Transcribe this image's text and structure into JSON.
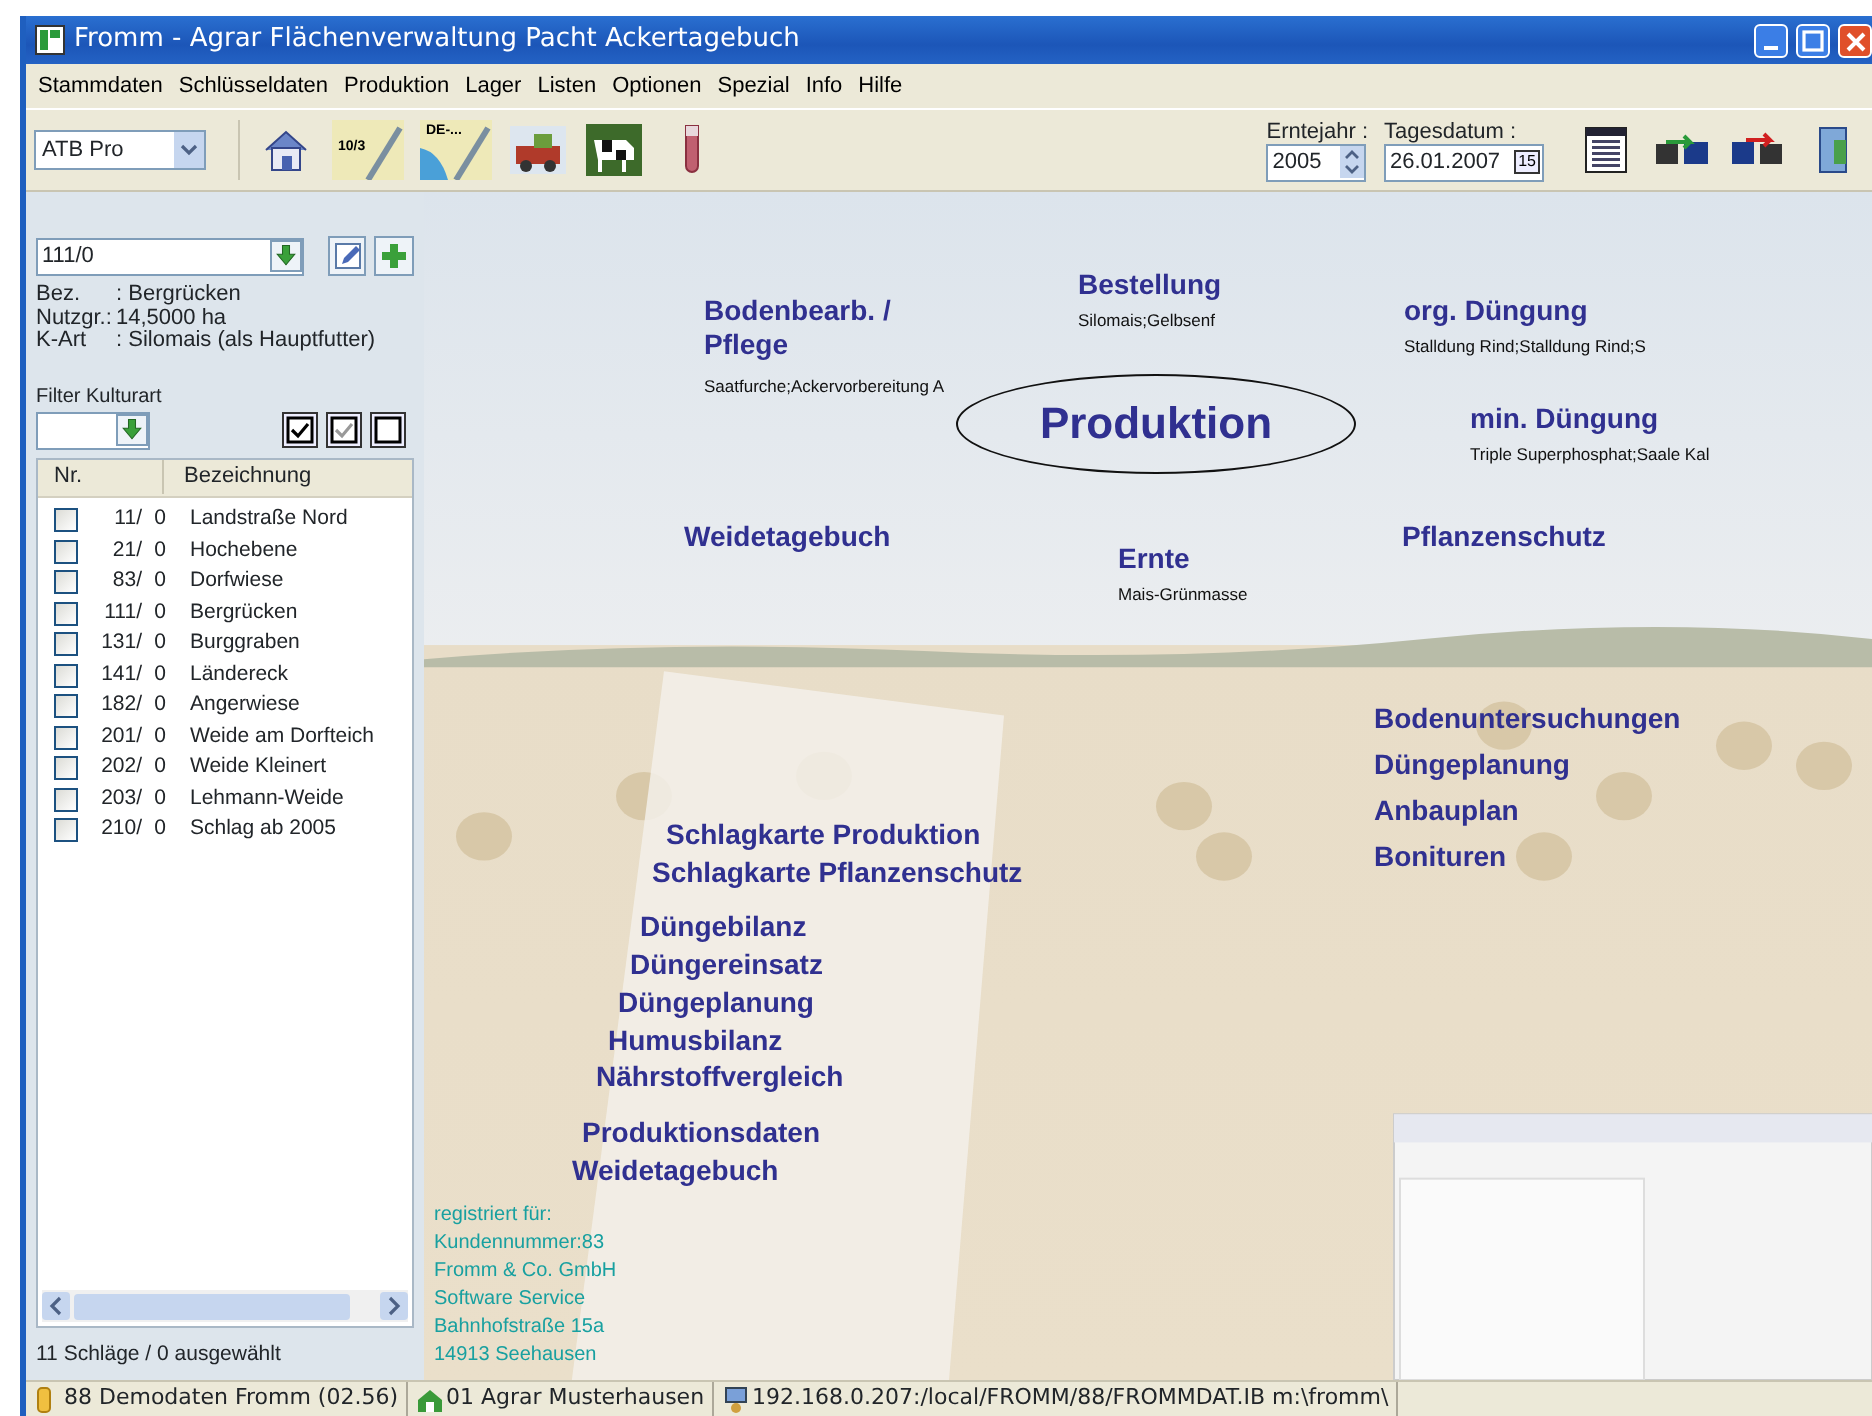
{
  "window": {
    "title": "Fromm - Agrar Flächenverwaltung Pacht Ackertagebuch"
  },
  "menu": [
    "Stammdaten",
    "Schlüsseldaten",
    "Produktion",
    "Lager",
    "Listen",
    "Optionen",
    "Spezial",
    "Info",
    "Hilfe"
  ],
  "toolbar": {
    "profile": "ATB Pro",
    "icon_texts": [
      "10/3",
      "DE-..."
    ],
    "harvest_year": {
      "label": "Erntejahr :",
      "value": "2005"
    },
    "date": {
      "label": "Tagesdatum :",
      "value": "26.01.2007",
      "button": "15"
    }
  },
  "sidebar": {
    "field_value": "111/0",
    "details": [
      {
        "label": "Bez.",
        "value": ": Bergrücken"
      },
      {
        "label": "Nutzgr.:",
        "value": "14,5000 ha"
      },
      {
        "label": "K-Art",
        "value": ": Silomais (als Hauptfutter)"
      }
    ],
    "filter_label": "Filter Kulturart",
    "columns": [
      "Nr.",
      "Bezeichnung"
    ],
    "rows": [
      {
        "nr": "11/",
        "sub": "0",
        "name": "Landstraße Nord",
        "checked": false
      },
      {
        "nr": "21/",
        "sub": "0",
        "name": "Hochebene",
        "checked": false
      },
      {
        "nr": "83/",
        "sub": "0",
        "name": "Dorfwiese",
        "checked": false
      },
      {
        "nr": "111/",
        "sub": "0",
        "name": "Bergrücken",
        "checked": false
      },
      {
        "nr": "131/",
        "sub": "0",
        "name": "Burggraben",
        "checked": false
      },
      {
        "nr": "141/",
        "sub": "0",
        "name": "Ländereck",
        "checked": false
      },
      {
        "nr": "182/",
        "sub": "0",
        "name": "Angerwiese",
        "checked": false
      },
      {
        "nr": "201/",
        "sub": "0",
        "name": "Weide am Dorfteich",
        "checked": false
      },
      {
        "nr": "202/",
        "sub": "0",
        "name": "Weide Kleinert",
        "checked": false
      },
      {
        "nr": "203/",
        "sub": "0",
        "name": "Lehmann-Weide",
        "checked": false
      },
      {
        "nr": "210/",
        "sub": "0",
        "name": "Schlag ab 2005",
        "checked": false
      }
    ],
    "summary": "11 Schläge / 0 ausgewählt"
  },
  "canvas": {
    "main": "Produktion",
    "groups": [
      {
        "label": "Bodenbearb. / Pflege",
        "sub": "Saatfurche;Ackervorbereitung A"
      },
      {
        "label": "Bestellung",
        "sub": "Silomais;Gelbsenf"
      },
      {
        "label": "org. Düngung",
        "sub": "Stalldung Rind;Stalldung Rind;S"
      },
      {
        "label": "min. Düngung",
        "sub": "Triple Superphosphat;Saale Kal"
      },
      {
        "label": "Weidetagebuch"
      },
      {
        "label": "Ernte",
        "sub": "Mais-Grünmasse"
      },
      {
        "label": "Pflanzenschutz"
      }
    ],
    "planning": [
      "Bodenuntersuchungen",
      "Düngeplanung",
      "Anbauplan",
      "Bonituren"
    ],
    "reports": [
      "Schlagkarte Produktion",
      "Schlagkarte Pflanzenschutz",
      "Düngebilanz",
      "Düngereinsatz",
      "Düngeplanung",
      "Humusbilanz",
      "Nährstoffvergleich",
      "Produktionsdaten",
      "Weidetagebuch"
    ],
    "registration": [
      "registriert für:",
      "Kundennummer:83",
      "Fromm & Co. GmbH",
      "Software Service",
      "Bahnhofstraße 15a",
      "14913 Seehausen"
    ]
  },
  "status_bar": [
    {
      "kind": "database",
      "text": "88 Demodaten Fromm (02.56)"
    },
    {
      "kind": "farm",
      "text": "01 Agrar Musterhausen"
    },
    {
      "kind": "network",
      "text": "192.168.0.207:/local/FROMM/88/FROMMDAT.IB m:\\fromm\\"
    }
  ]
}
